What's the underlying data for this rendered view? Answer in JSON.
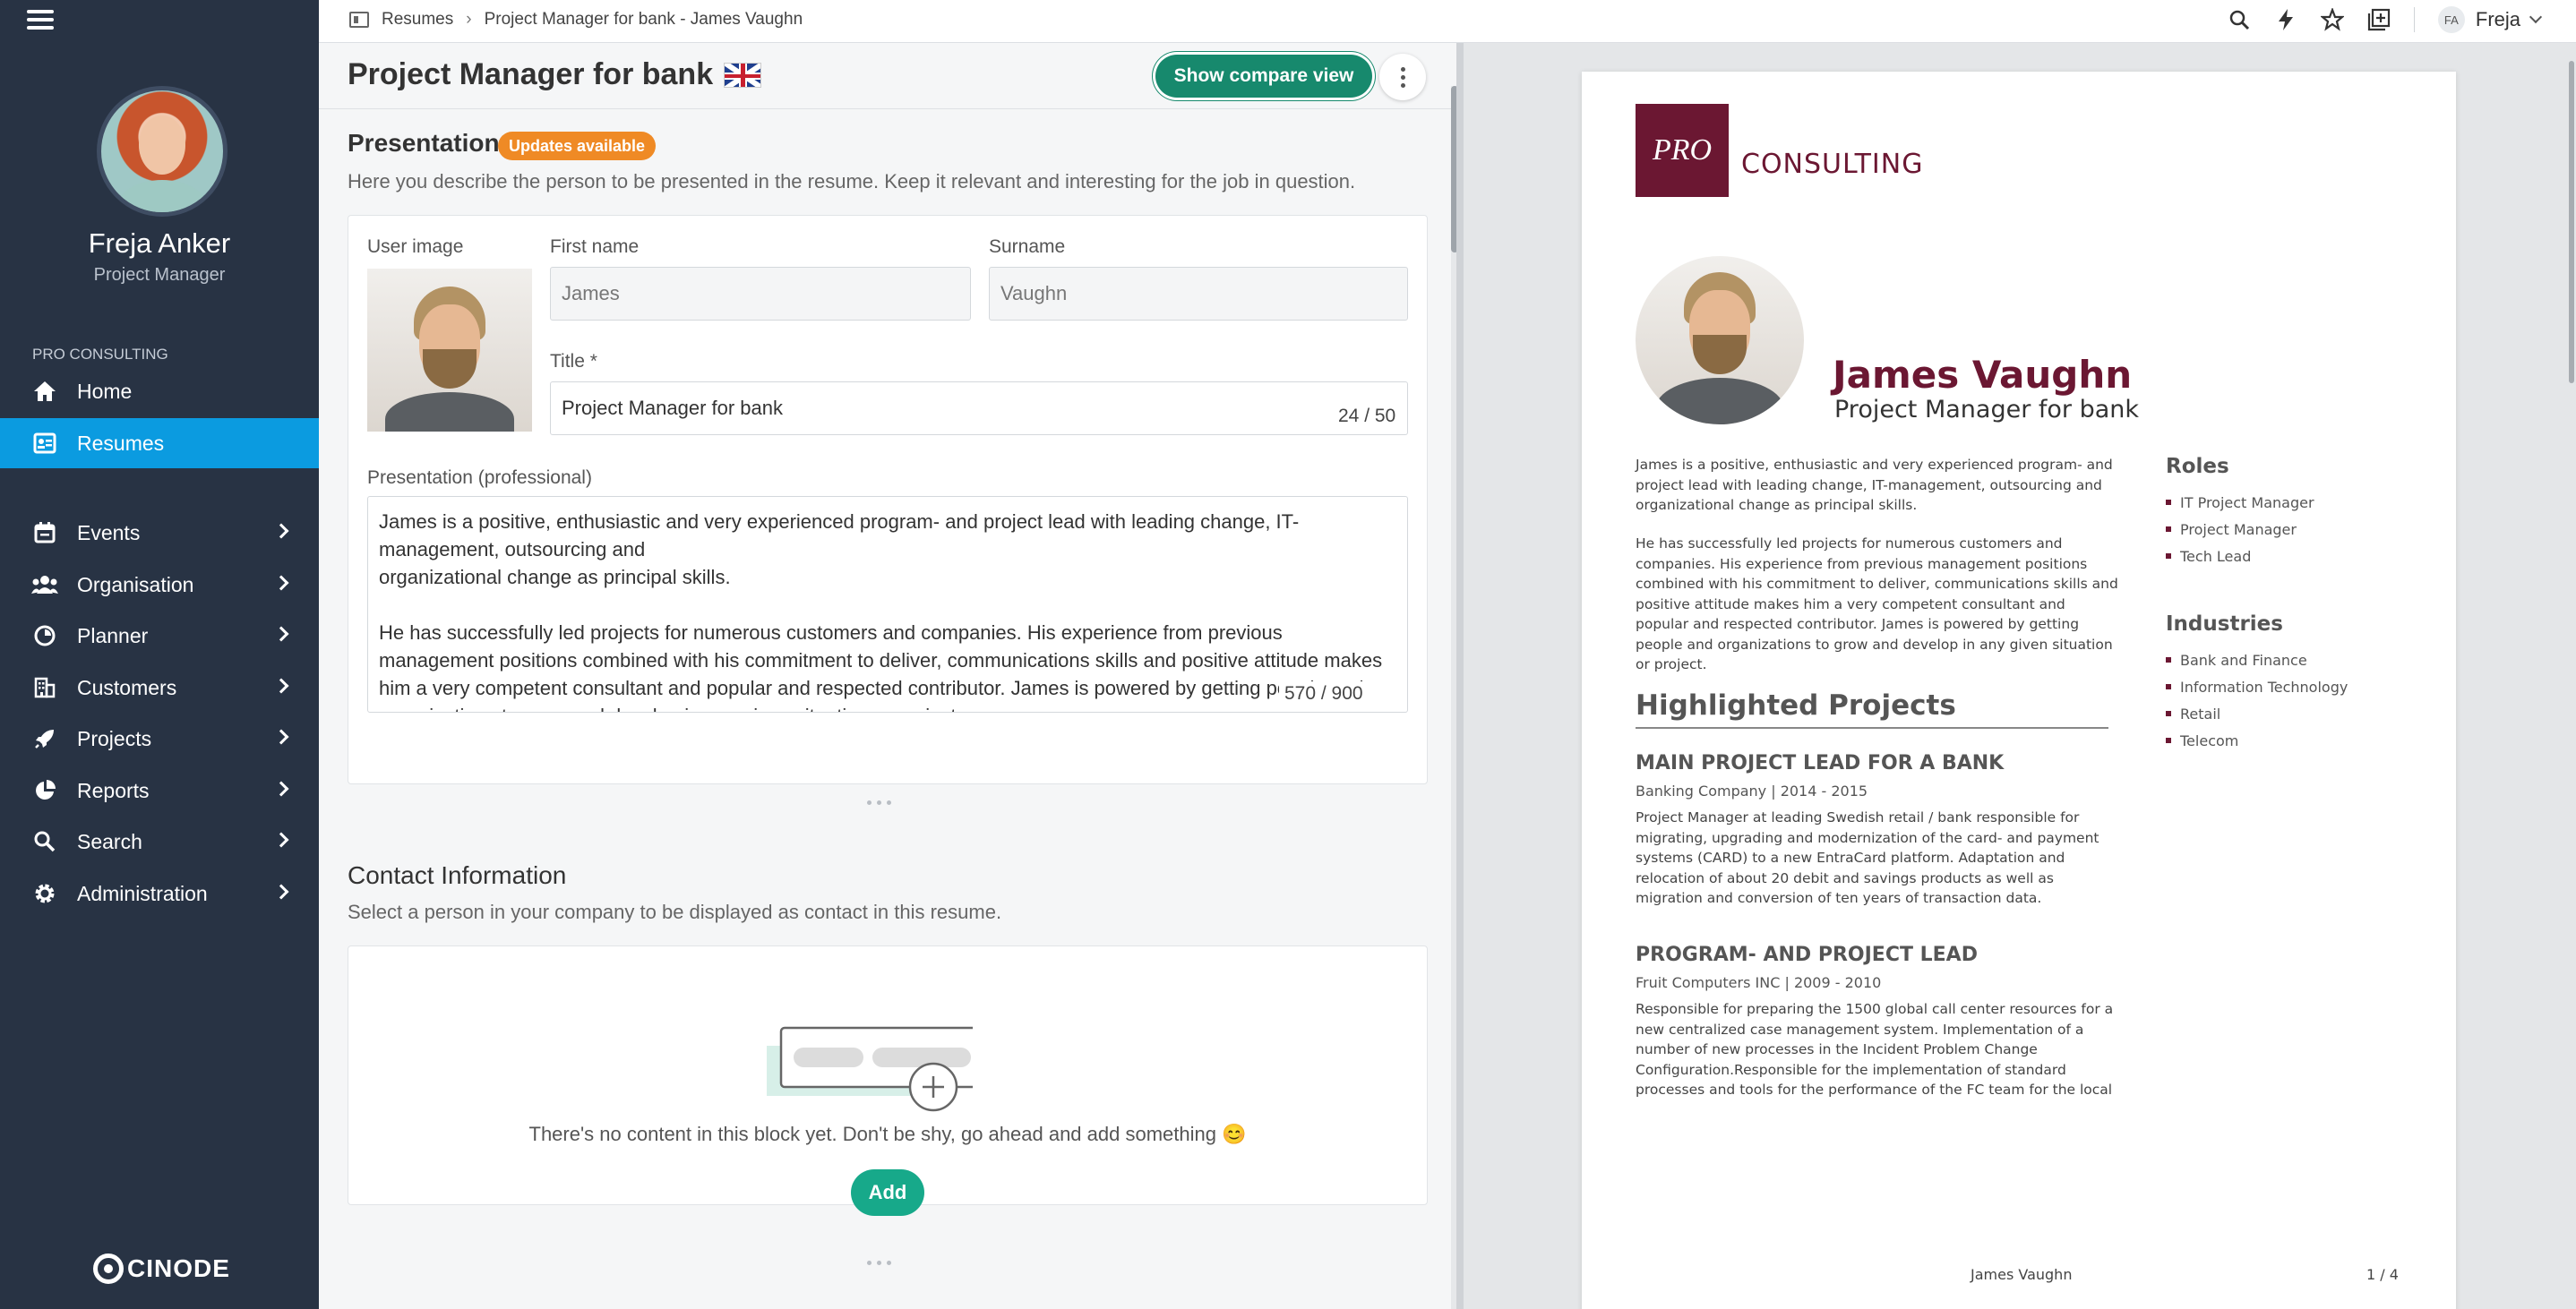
{
  "sidebar": {
    "user_name": "Freja Anker",
    "user_role": "Project Manager",
    "org_label": "PRO CONSULTING",
    "items": [
      {
        "label": "Home",
        "icon": "home-icon"
      },
      {
        "label": "Resumes",
        "icon": "resume-icon",
        "active": true
      },
      {
        "label": "Events",
        "icon": "calendar-icon"
      },
      {
        "label": "Organisation",
        "icon": "people-icon"
      },
      {
        "label": "Planner",
        "icon": "pie-icon"
      },
      {
        "label": "Customers",
        "icon": "building-icon"
      },
      {
        "label": "Projects",
        "icon": "rocket-icon"
      },
      {
        "label": "Reports",
        "icon": "chart-pie-icon"
      },
      {
        "label": "Search",
        "icon": "search-icon"
      },
      {
        "label": "Administration",
        "icon": "gear-icon"
      }
    ],
    "brand": "CINODE",
    "active_color": "#0b9be0",
    "bg_color": "#283344"
  },
  "topbar": {
    "breadcrumb": [
      "Resumes",
      "Project Manager for bank - James Vaughn"
    ],
    "user_initials": "FA",
    "user_name": "Freja"
  },
  "editor": {
    "title": "Project Manager for bank",
    "compare_button": "Show compare view",
    "presentation": {
      "heading": "Presentation",
      "badge": "Updates available",
      "description": "Here you describe the person to be presented in the resume. Keep it relevant and interesting for the job in question.",
      "user_image_label": "User image",
      "first_name_label": "First name",
      "first_name": "James",
      "surname_label": "Surname",
      "surname": "Vaughn",
      "title_label": "Title *",
      "title_value": "Project Manager for bank",
      "title_counter": "24 / 50",
      "text_label": "Presentation (professional)",
      "text": "James is a positive, enthusiastic and very experienced program- and project lead with leading change, IT-management, outsourcing and\norganizational change as principal skills.\n\nHe has successfully led projects for numerous customers and companies. His experience from previous management positions combined with his commitment to deliver, communications skills and positive attitude makes him a very competent consultant and popular and respected contributor. James is powered by getting people and organizations to grow and develop in any given situation or project.",
      "text_counter": "570 / 900"
    },
    "contact": {
      "heading": "Contact Information",
      "description": "Select a person in your company to be displayed as contact in this resume.",
      "empty_text": "There's no content in this block yet. Don't be shy, go ahead and add something 😊",
      "add_button": "Add"
    }
  },
  "preview": {
    "logo_mark": "PRO",
    "logo_text": "CONSULTING",
    "brand_color": "#6b1732",
    "name": "James Vaughn",
    "subtitle": "Project Manager for bank",
    "para1": "James is a positive, enthusiastic and very experienced program- and project lead with leading change, IT-management, outsourcing and organizational change as principal skills.",
    "para2": "He has successfully led projects for numerous customers and companies. His experience from previous management positions combined with his commitment to deliver, communications skills and positive attitude makes him a very competent consultant and popular and respected contributor. James is powered by getting people and organizations to grow and develop in any given situation or project.",
    "roles_title": "Roles",
    "roles": [
      "IT Project Manager",
      "Project Manager",
      "Tech Lead"
    ],
    "industries_title": "Industries",
    "industries": [
      "Bank and Finance",
      "Information Technology",
      "Retail",
      "Telecom"
    ],
    "highlighted_title": "Highlighted Projects",
    "projects": [
      {
        "title": "MAIN PROJECT LEAD FOR A BANK",
        "meta": "Banking Company | 2014 - 2015",
        "desc": "Project Manager at leading Swedish retail / bank responsible for migrating, upgrading and modernization of the card- and payment systems (CARD) to a new EntraCard platform. Adaptation and relocation of about 20 debit and savings products as well as migration and conversion of ten years of transaction data."
      },
      {
        "title": "PROGRAM- AND PROJECT LEAD",
        "meta": "Fruit Computers INC | 2009 - 2010",
        "desc": "Responsible for preparing the 1500 global call center resources for a new centralized case management system. Implementation of a number of new processes in the Incident Problem Change Configuration.Responsible for the implementation of standard processes and tools for the performance of the FC team for the local"
      }
    ],
    "footer_name": "James Vaughn",
    "footer_page": "1 / 4"
  }
}
